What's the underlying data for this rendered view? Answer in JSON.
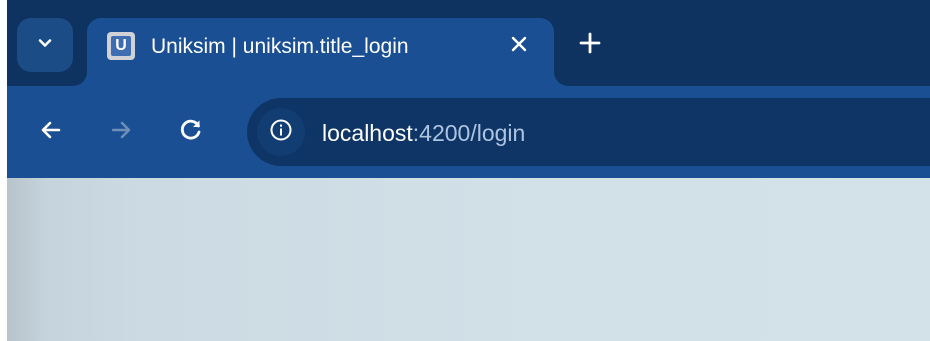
{
  "browser": {
    "tab": {
      "title": "Uniksim | uniksim.title_login",
      "favicon_letter": "U",
      "favicon_icon": "uniksim-logo-icon",
      "close_icon": "close-icon"
    },
    "tab_search_icon": "chevron-down-icon",
    "new_tab_icon": "plus-icon",
    "toolbar": {
      "back_icon": "arrow-left-icon",
      "forward_icon": "arrow-right-icon",
      "reload_icon": "reload-icon",
      "site_info_icon": "info-icon"
    },
    "address": {
      "host": "localhost",
      "path": ":4200/login"
    },
    "colors": {
      "tab_strip": "#0e3360",
      "active_tab": "#1a5093",
      "omnibox": "#0e3566",
      "page_background": "#d2e0e8"
    }
  }
}
